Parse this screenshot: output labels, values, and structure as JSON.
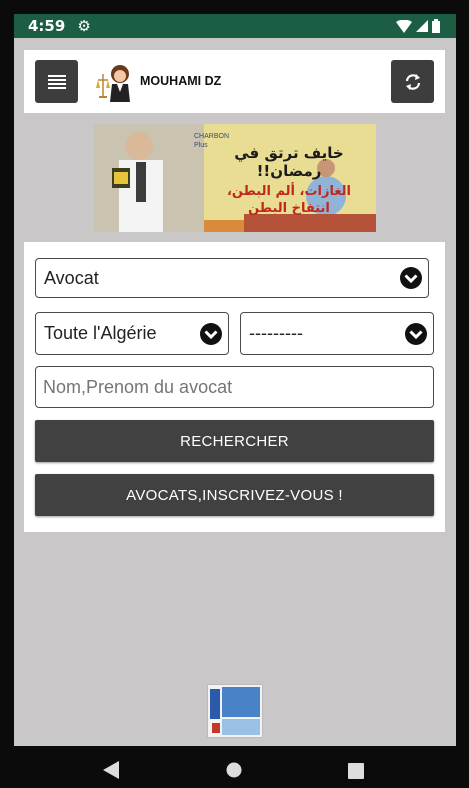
{
  "status_bar": {
    "time": "4:59"
  },
  "header": {
    "brand": "MOUHAMI DZ"
  },
  "ad": {
    "line1": "خايف ترتق في رمضان!!",
    "line2": "الغازات، ألم البطن،",
    "line3": "انتفاخ البطن",
    "brand_mark": "CHARBON Plus"
  },
  "form": {
    "category_select": "Avocat",
    "region_select": "Toute l'Algérie",
    "sub_select": "---------",
    "name_placeholder": "Nom,Prenom du avocat",
    "search_button": "RECHERCHER",
    "register_button": "AVOCATS,INSCRIVEZ-VOUS !"
  }
}
